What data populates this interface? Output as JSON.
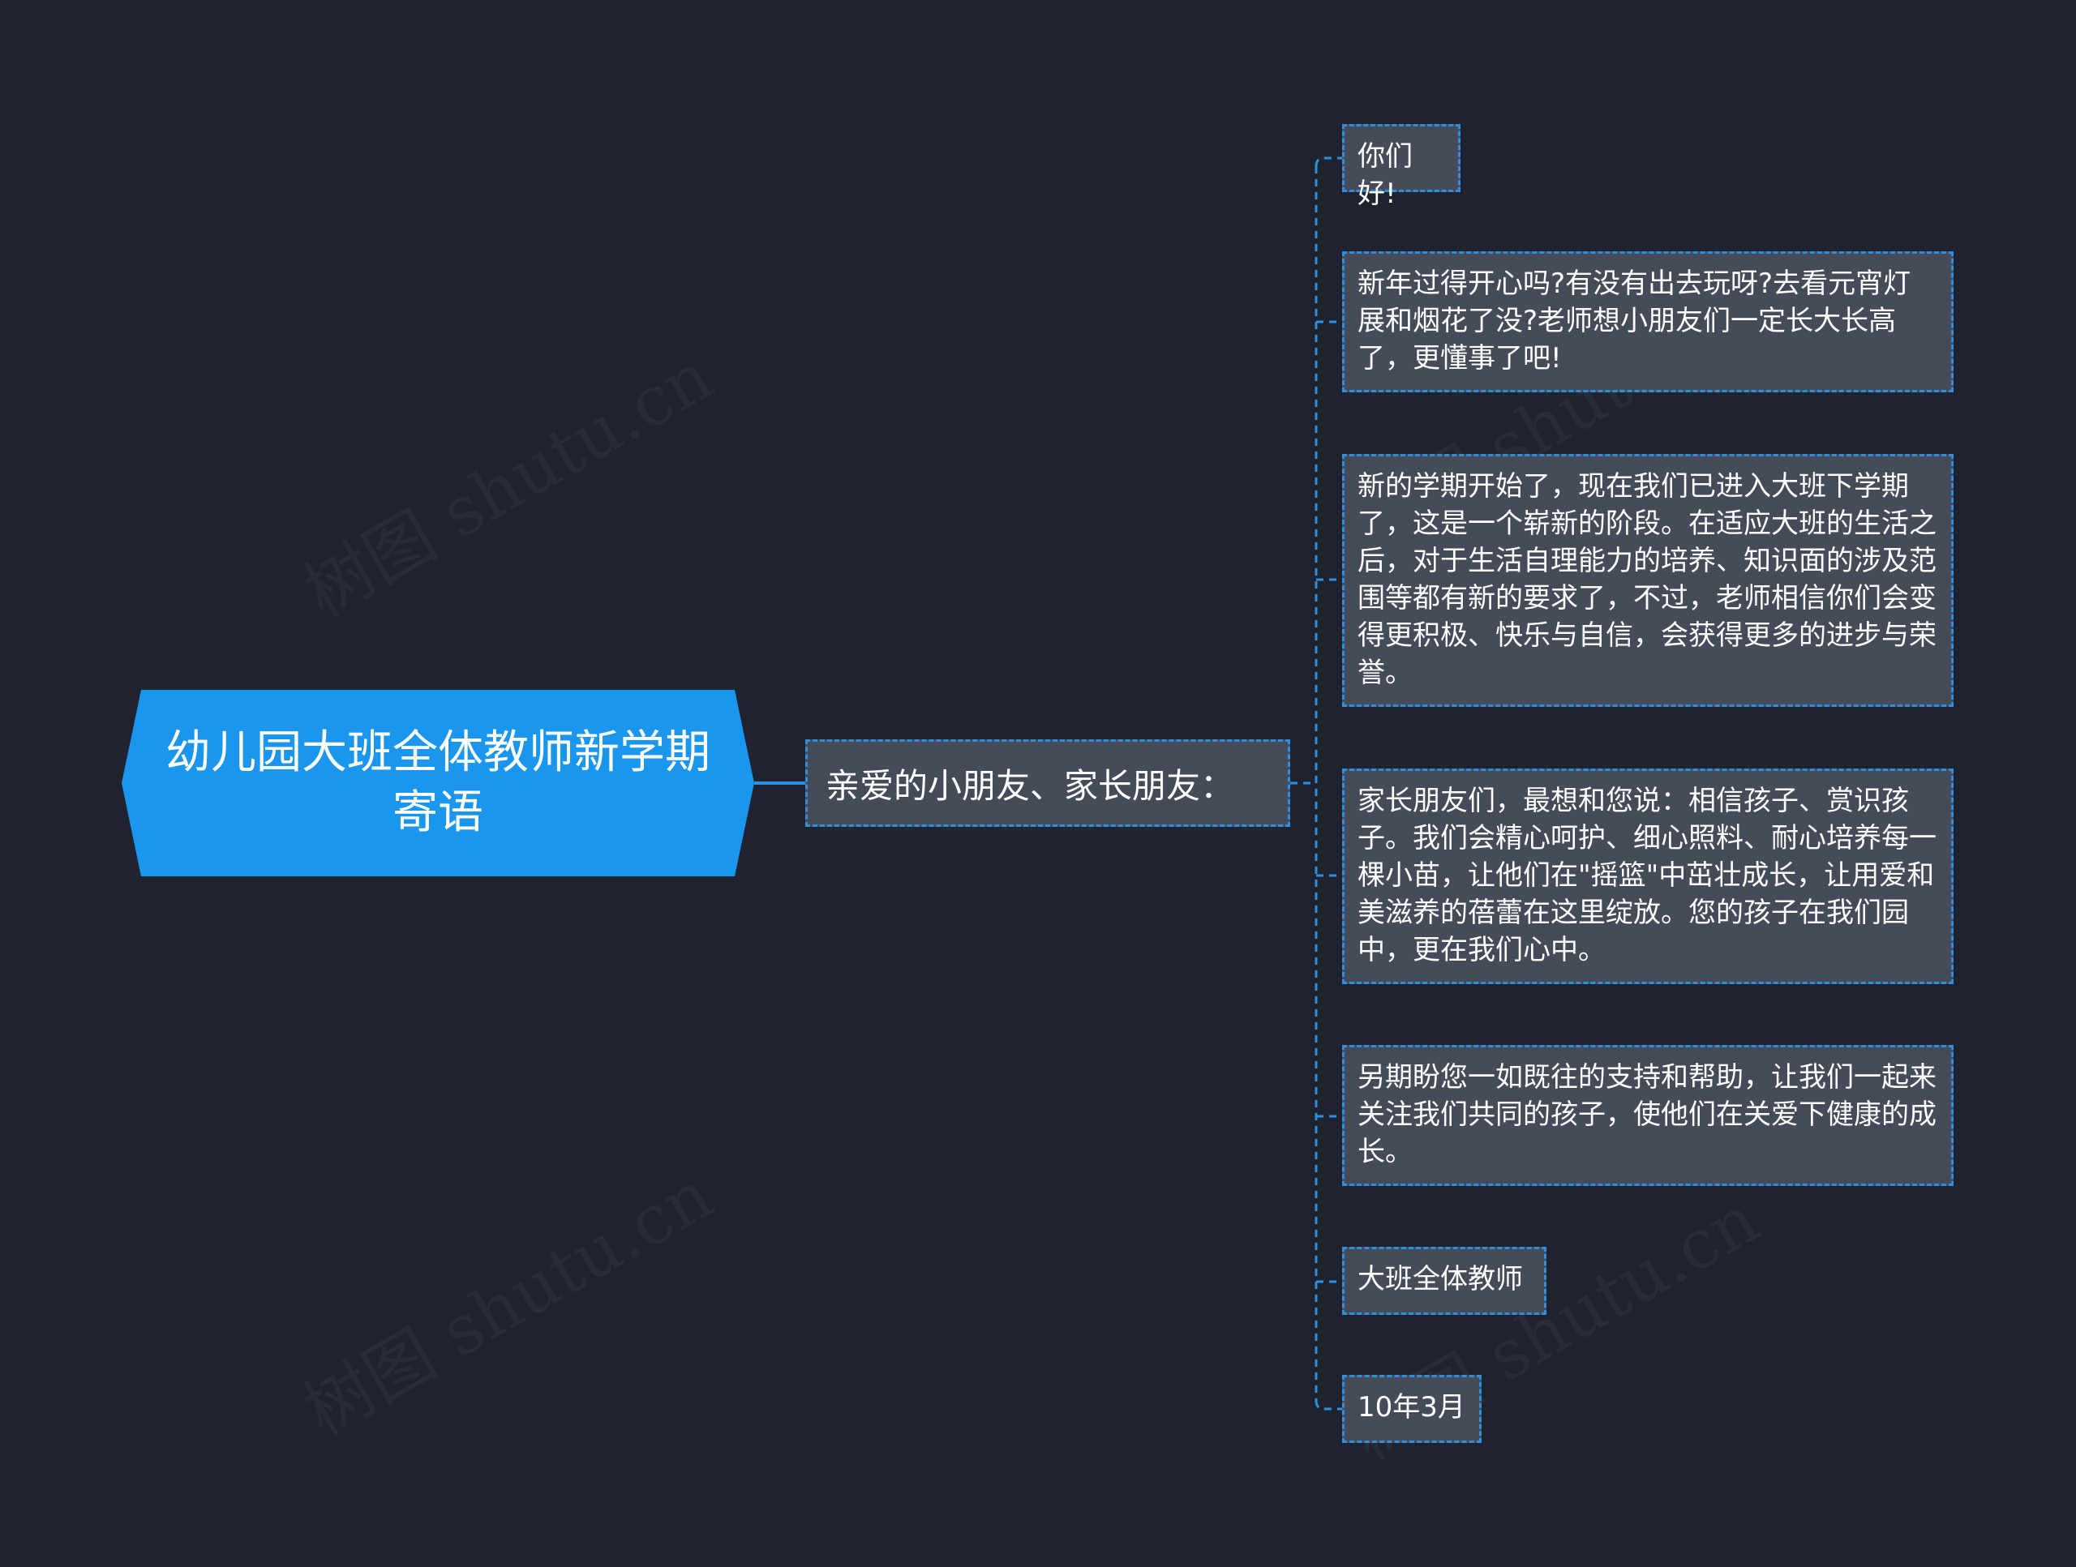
{
  "colors": {
    "background": "#1f2330",
    "root_fill": "#1a96ee",
    "node_fill": "#464b59",
    "connector": "#2d8fe0",
    "text": "#ffffff"
  },
  "watermarks": [
    "树图 shutu.cn",
    "树图 shutu.cn",
    "树图 shutu.cn",
    "树图 shutu.cn"
  ],
  "mindmap": {
    "root": "幼儿园大班全体教师新学期寄语",
    "branch": "亲爱的小朋友、家长朋友：",
    "leaves": [
      "你们好!",
      "新年过得开心吗?有没有出去玩呀?去看元宵灯展和烟花了没?老师想小朋友们一定长大长高了，更懂事了吧!",
      "新的学期开始了，现在我们已进入大班下学期了，这是一个崭新的阶段。在适应大班的生活之后，对于生活自理能力的培养、知识面的涉及范围等都有新的要求了，不过，老师相信你们会变得更积极、快乐与自信，会获得更多的进步与荣誉。",
      "家长朋友们，最想和您说：相信孩子、赏识孩子。我们会精心呵护、细心照料、耐心培养每一棵小苗，让他们在\"摇篮\"中茁壮成长，让用爱和美滋养的蓓蕾在这里绽放。您的孩子在我们园中，更在我们心中。",
      "另期盼您一如既往的支持和帮助，让我们一起来关注我们共同的孩子，使他们在关爱下健康的成长。",
      "大班全体教师",
      "10年3月"
    ]
  }
}
